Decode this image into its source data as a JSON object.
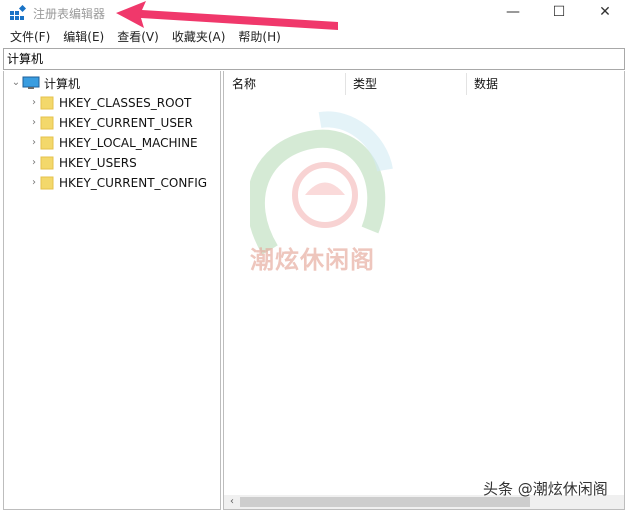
{
  "window": {
    "title": "注册表编辑器",
    "controls": {
      "minimize": "—",
      "maximize": "☐",
      "close": "✕"
    }
  },
  "menu": [
    {
      "label": "文件(F)"
    },
    {
      "label": "编辑(E)"
    },
    {
      "label": "查看(V)"
    },
    {
      "label": "收藏夹(A)"
    },
    {
      "label": "帮助(H)"
    }
  ],
  "address": {
    "path": "计算机"
  },
  "tree": {
    "root": "计算机",
    "items": [
      {
        "label": "HKEY_CLASSES_ROOT"
      },
      {
        "label": "HKEY_CURRENT_USER"
      },
      {
        "label": "HKEY_LOCAL_MACHINE"
      },
      {
        "label": "HKEY_USERS"
      },
      {
        "label": "HKEY_CURRENT_CONFIG"
      }
    ]
  },
  "list": {
    "columns": [
      {
        "label": "名称"
      },
      {
        "label": "类型"
      },
      {
        "label": "数据"
      }
    ]
  },
  "overlay": {
    "watermark_text": "潮炫休闲阁",
    "credit_text": "头条 @潮炫休闲阁",
    "arrow_color": "#f0386b"
  },
  "colors": {
    "folder": "#f3d86b",
    "border": "#bdbdbd"
  }
}
